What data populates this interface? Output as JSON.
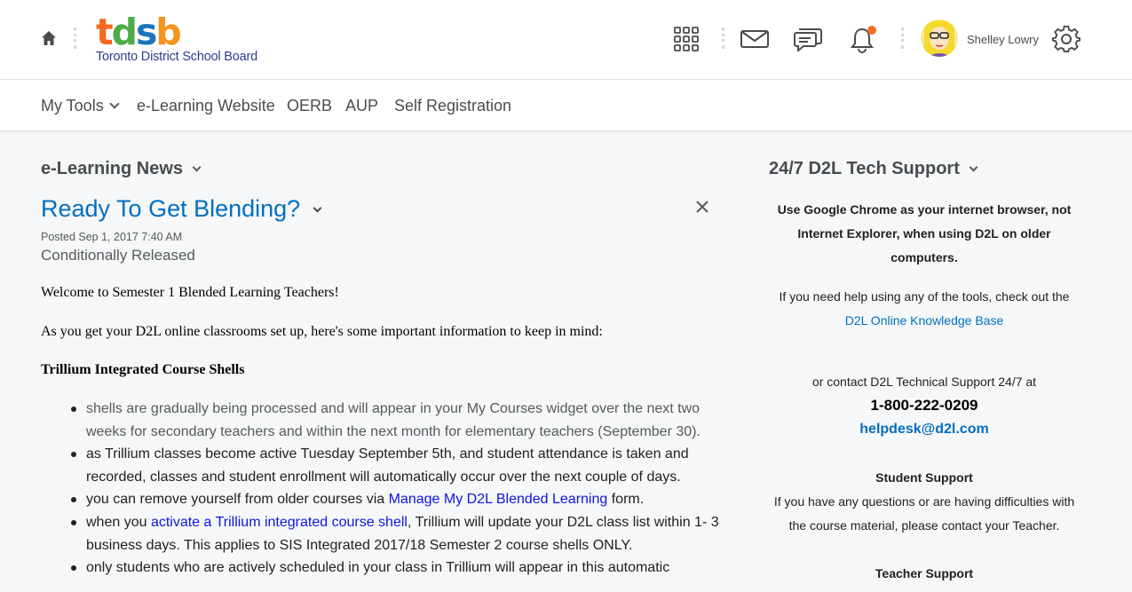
{
  "header": {
    "logo_letters": [
      {
        "ch": "t",
        "color": "#f26a21"
      },
      {
        "ch": "d",
        "color": "#4dab48"
      },
      {
        "ch": "s",
        "color": "#1a75bb"
      },
      {
        "ch": "b",
        "color": "#f7941d"
      }
    ],
    "logo_subtitle": "Toronto District School Board",
    "username": "Shelley Lowry",
    "icons": [
      "home-icon",
      "apps-grid-icon",
      "mail-icon",
      "chat-icon",
      "bell-icon",
      "avatar",
      "gear-icon"
    ]
  },
  "nav": {
    "items": [
      "My Tools",
      "e-Learning Website",
      "OERB",
      "AUP",
      "Self Registration"
    ]
  },
  "news": {
    "widget_title": "e-Learning News",
    "item_title": "Ready To Get Blending?",
    "posted": "Posted Sep 1, 2017 7:40 AM",
    "status": "Conditionally Released",
    "intro": "Welcome to Semester 1 Blended Learning Teachers!",
    "lead": "As you get your D2L online classrooms set up, here's some important information to keep in mind:",
    "section_heading": "Trillium Integrated Course Shells",
    "bullets": [
      {
        "text": "shells are gradually being processed and will appear in your My Courses widget over the next two weeks for secondary teachers and within the next month for elementary teachers (September 30)."
      },
      {
        "text": "as Trillium classes become active Tuesday September 5th, and student attendance is taken and recorded, classes and student enrollment will automatically occur over the next couple of days."
      },
      {
        "before": "you can remove yourself from older courses via ",
        "link": "Manage My D2L Blended Learning",
        "after": " form."
      },
      {
        "before": "when you ",
        "link": "activate a Trillium integrated course shell",
        "after": ", Trillium will update your D2L class list within 1- 3 business days.  This applies to SIS Integrated 2017/18 Semester 2 course shells ONLY."
      },
      {
        "text": "only students who are actively scheduled in your class in Trillium will appear in this automatic"
      }
    ]
  },
  "support": {
    "widget_title": "24/7 D2L Tech Support",
    "browser_notice_line1": "Use Google Chrome as your internet browser, not",
    "browser_notice_line2": "Internet Explorer, when using D2L on older",
    "browser_notice_line3": "computers.",
    "help_text": "If you need help using any of the tools, check out the",
    "kb_link": "D2L Online Knowledge Base",
    "contact_text": "or contact D2L Technical Support 24/7 at",
    "phone": "1-800-222-0209",
    "email": "helpdesk@d2l.com",
    "student_heading": "Student Support",
    "student_text_line1": "If you have any questions or are having difficulties with",
    "student_text_line2": "the course material, please contact your Teacher.",
    "teacher_heading": "Teacher Support"
  }
}
